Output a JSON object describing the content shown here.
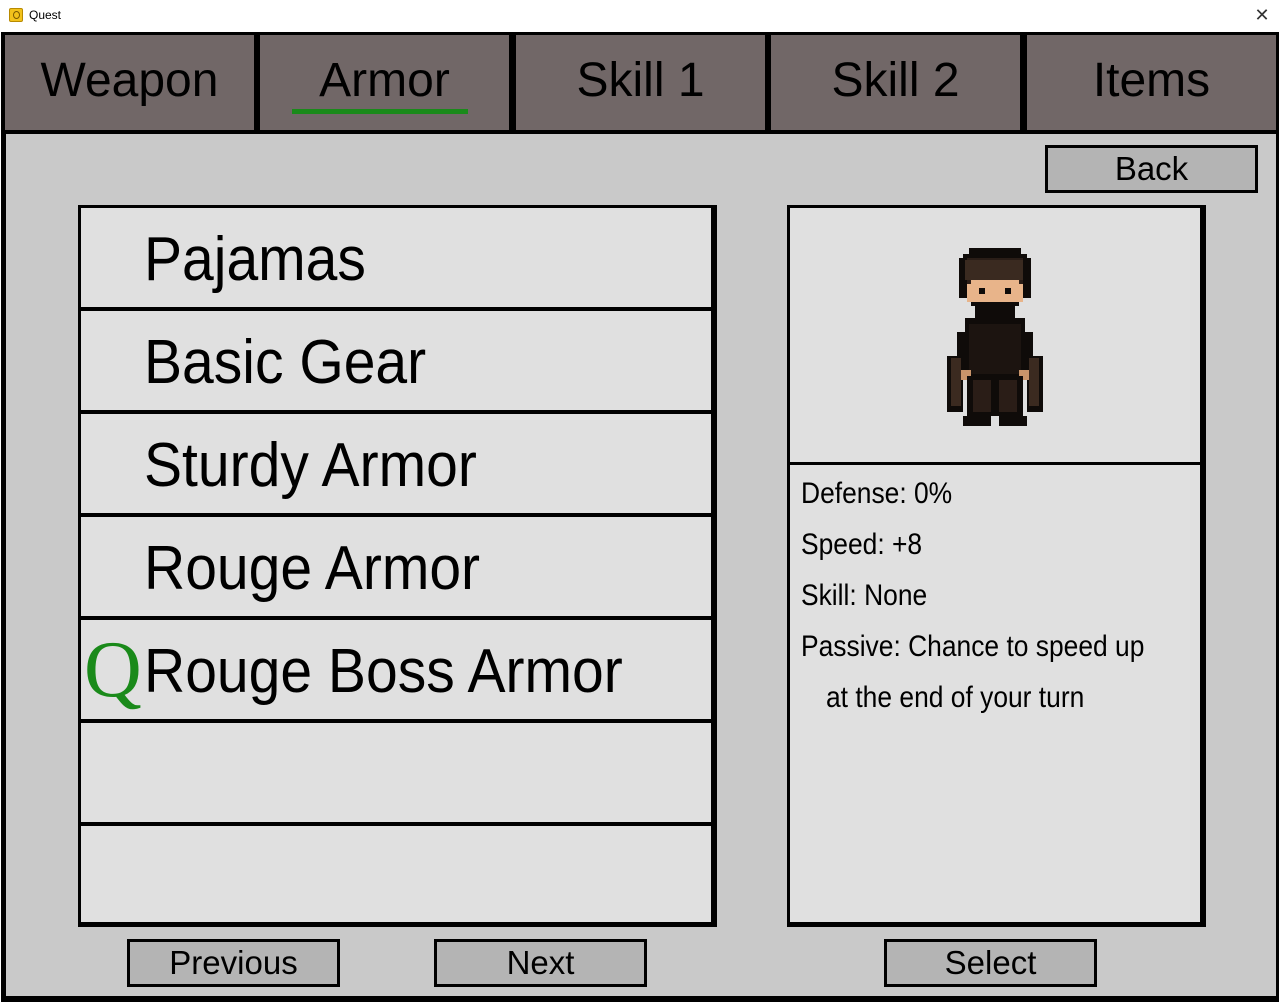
{
  "window": {
    "title": "Quest",
    "close_glyph": "✕"
  },
  "tabs": [
    {
      "label": "Weapon",
      "active": false
    },
    {
      "label": "Armor",
      "active": true
    },
    {
      "label": "Skill 1",
      "active": false
    },
    {
      "label": "Skill 2",
      "active": false
    },
    {
      "label": "Items",
      "active": false
    }
  ],
  "back_label": "Back",
  "armor_list": [
    {
      "label": "Pajamas",
      "equipped": false
    },
    {
      "label": "Basic Gear",
      "equipped": false
    },
    {
      "label": "Sturdy Armor",
      "equipped": false
    },
    {
      "label": "Rouge Armor",
      "equipped": false
    },
    {
      "label": "Rouge Boss Armor",
      "equipped": true
    },
    {
      "label": "",
      "equipped": false
    },
    {
      "label": "",
      "equipped": false
    }
  ],
  "equipped_marker": "Q",
  "details": {
    "defense": "Defense: 0%",
    "speed": "Speed: +8",
    "skill": "Skill: None",
    "passive_line1": "Passive: Chance to speed up",
    "passive_line2": "at the end of your turn"
  },
  "buttons": {
    "previous": "Previous",
    "next": "Next",
    "select": "Select"
  },
  "colors": {
    "tab_bg": "#716767",
    "active_underline": "#1a8a1a",
    "equipped_marker": "#1a8a1a",
    "panel_bg": "#e0e0e0",
    "content_bg": "#c9c9c9",
    "button_bg": "#b4b4b4"
  },
  "icons": {
    "app": "quest-app-icon",
    "close": "close-icon",
    "portrait": "character-sprite"
  }
}
